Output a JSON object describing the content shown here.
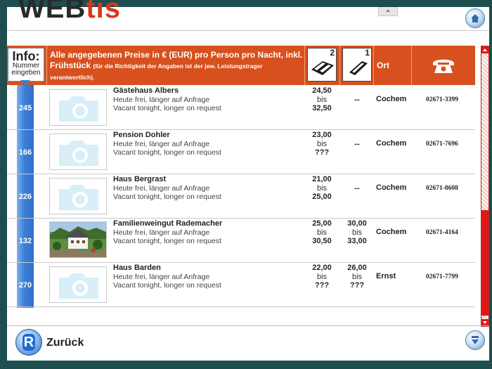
{
  "header": {
    "logo_dark": "WEB",
    "logo_accent": "tis"
  },
  "table_header": {
    "info_title": "Info:",
    "info_sub_1": "Nummer",
    "info_sub_2": "eingeben",
    "price_note_main": "Alle angegebenen Preise in € (EUR) pro Person pro Nacht, inkl. Frühstück",
    "price_note_small": "(für die Richtigkeit der Angaben ist der jew. Leistungstrager verantwortlich).",
    "col_double": "2",
    "col_single": "1",
    "col_ort": "Ort"
  },
  "listings": [
    {
      "num": "245",
      "name": "Gästehaus Albers",
      "line1": "Heute frei, länger auf Anfrage",
      "line2": "Vacant tonight, longer on request",
      "double": {
        "from": "24,50",
        "bis": "bis",
        "to": "32,50"
      },
      "single": {
        "dash": "--"
      },
      "ort": "Cochem",
      "tel": "02671-3399",
      "photo": "placeholder"
    },
    {
      "num": "166",
      "name": "Pension Dohler",
      "line1": "Heute frei, länger auf Anfrage",
      "line2": "Vacant tonight, longer on request",
      "double": {
        "from": "23,00",
        "bis": "bis",
        "to": "???"
      },
      "single": {
        "dash": "--"
      },
      "ort": "Cochem",
      "tel": "02671-7696",
      "photo": "placeholder"
    },
    {
      "num": "226",
      "name": "Haus Bergrast",
      "line1": "Heute frei, länger auf Anfrage",
      "line2": "Vacant tonight, longer on request",
      "double": {
        "from": "21,00",
        "bis": "bis",
        "to": "25,00"
      },
      "single": {
        "dash": "--"
      },
      "ort": "Cochem",
      "tel": "02671-8608",
      "photo": "placeholder"
    },
    {
      "num": "132",
      "name": "Familienweingut Rademacher",
      "line1": "Heute frei, länger auf Anfrage",
      "line2": "Vacant tonight, longer on request",
      "double": {
        "from": "25,00",
        "bis": "bis",
        "to": "30,50"
      },
      "single": {
        "from": "30,00",
        "bis": "bis",
        "to": "33,00"
      },
      "ort": "Cochem",
      "tel": "02671-4164",
      "photo": "house"
    },
    {
      "num": "270",
      "name": "Haus Barden",
      "line1": "Heute frei, länger auf Anfrage",
      "line2": "Vacant tonight, longer on request",
      "double": {
        "from": "22,00",
        "bis": "bis",
        "to": "???"
      },
      "single": {
        "from": "26,00",
        "bis": "bis",
        "to": "???"
      },
      "ort": "Ernst",
      "tel": "02671-7799",
      "photo": "placeholder"
    }
  ],
  "footer": {
    "back_label": "Zurück",
    "back_icon_letter": "R"
  },
  "icons": {
    "home": "home-icon",
    "scroll_down": "scroll-down-icon",
    "phone": "telephone-icon",
    "double_bed": "double-bed-icon",
    "single_bed": "single-bed-icon",
    "camera": "camera-placeholder-icon"
  },
  "colors": {
    "header_orange": "#d7501e",
    "scroll_red": "#e01518",
    "number_blue": "#3b7fd8",
    "accent_red": "#d7381a"
  }
}
